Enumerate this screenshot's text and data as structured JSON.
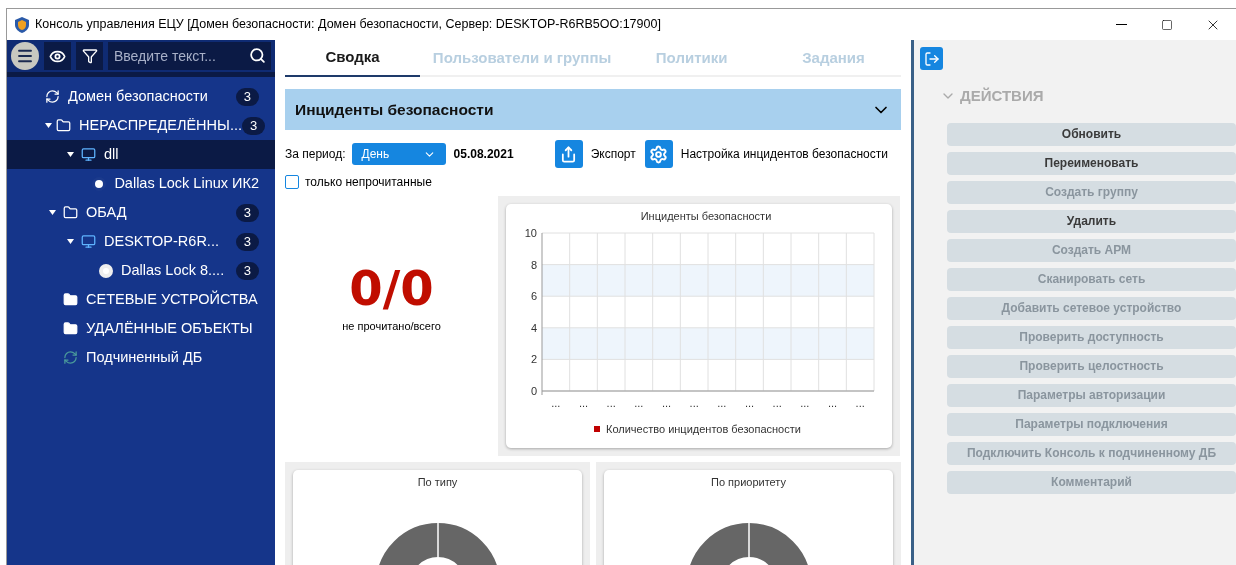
{
  "window": {
    "title": "Консоль управления ЕЦУ [Домен безопасности: Домен безопасности, Сервер: DESKTOP-R6RB5OO:17900]"
  },
  "sidebar": {
    "search": {
      "placeholder": "Введите текст..."
    },
    "tree": [
      {
        "label": "Домен безопасности",
        "kind": "domain",
        "badge": "3",
        "selected": false,
        "children": [
          {
            "label": "НЕРАСПРЕДЕЛЁННЫ...",
            "kind": "folder",
            "badge": "3",
            "selected": false,
            "expanded": true,
            "children": [
              {
                "label": "dll",
                "kind": "computer",
                "selected": true,
                "expanded": true,
                "children": [
                  {
                    "label": "Dallas Lock Linux ИК2",
                    "kind": "agent-linux",
                    "selected": false
                  }
                ]
              }
            ]
          },
          {
            "label": "ОБАД",
            "kind": "folder",
            "badge": "3",
            "selected": false,
            "expanded": true,
            "children": [
              {
                "label": "DESKTOP-R6R...",
                "kind": "computer",
                "badge": "3",
                "selected": false,
                "expanded": true,
                "children": [
                  {
                    "label": "Dallas Lock 8....",
                    "kind": "agent-80",
                    "badge": "3",
                    "selected": false
                  }
                ]
              }
            ]
          },
          {
            "label": "СЕТЕВЫЕ УСТРОЙСТВА",
            "kind": "folder-filled",
            "selected": false
          },
          {
            "label": "УДАЛЁННЫЕ ОБЪЕКТЫ",
            "kind": "folder-filled",
            "selected": false
          },
          {
            "label": "Подчиненный ДБ",
            "kind": "subdomain",
            "selected": false
          }
        ]
      }
    ]
  },
  "tabs": [
    {
      "label": "Сводка",
      "selected": true
    },
    {
      "label": "Пользователи и группы",
      "selected": false
    },
    {
      "label": "Политики",
      "selected": false
    },
    {
      "label": "Задания",
      "selected": false
    }
  ],
  "section": {
    "title": "Инциденты безопасности",
    "expanded": true,
    "period_label": "За период:",
    "period": "День",
    "date": "05.08.2021",
    "export": "Экспорт",
    "settings": "Настройка инцидентов безопасности",
    "unread_only": {
      "label": "только непрочитанные",
      "checked": false
    },
    "counter": {
      "value": "0/0",
      "caption": "не прочитано/всего"
    },
    "chart_data": {
      "type": "line",
      "grid": true,
      "title": "Инциденты безопасности",
      "categories": [
        "...",
        "...",
        "...",
        "...",
        "...",
        "...",
        "...",
        "...",
        "...",
        "...",
        "...",
        "..."
      ],
      "ylim": [
        0,
        10
      ],
      "yticks": [
        0,
        2,
        4,
        6,
        8,
        10
      ],
      "series": [
        {
          "name": "Количество инцидентов безопасности",
          "color": "#c00000",
          "values": [
            null,
            null,
            null,
            null,
            null,
            null,
            null,
            null,
            null,
            null,
            null,
            null
          ]
        }
      ]
    },
    "donuts": [
      {
        "title": "По типу"
      },
      {
        "title": "По приоритету"
      }
    ]
  },
  "actions": {
    "title": "ДЕЙСТВИЯ",
    "expanded": true,
    "buttons": [
      {
        "label": "Обновить",
        "disabled": false
      },
      {
        "label": "Переименовать",
        "disabled": false
      },
      {
        "label": "Создать группу",
        "disabled": true
      },
      {
        "label": "Удалить",
        "disabled": false
      },
      {
        "label": "Создать АРМ",
        "disabled": true
      },
      {
        "label": "Сканировать сеть",
        "disabled": true
      },
      {
        "label": "Добавить сетевое устройство",
        "disabled": true
      },
      {
        "label": "Проверить доступность",
        "disabled": true
      },
      {
        "label": "Проверить целостность",
        "disabled": true
      },
      {
        "label": "Параметры авторизации",
        "disabled": true
      },
      {
        "label": "Параметры подключения",
        "disabled": true
      },
      {
        "label": "Подключить Консоль к подчиненному ДБ",
        "disabled": true
      },
      {
        "label": "Комментарий",
        "disabled": true
      }
    ]
  }
}
